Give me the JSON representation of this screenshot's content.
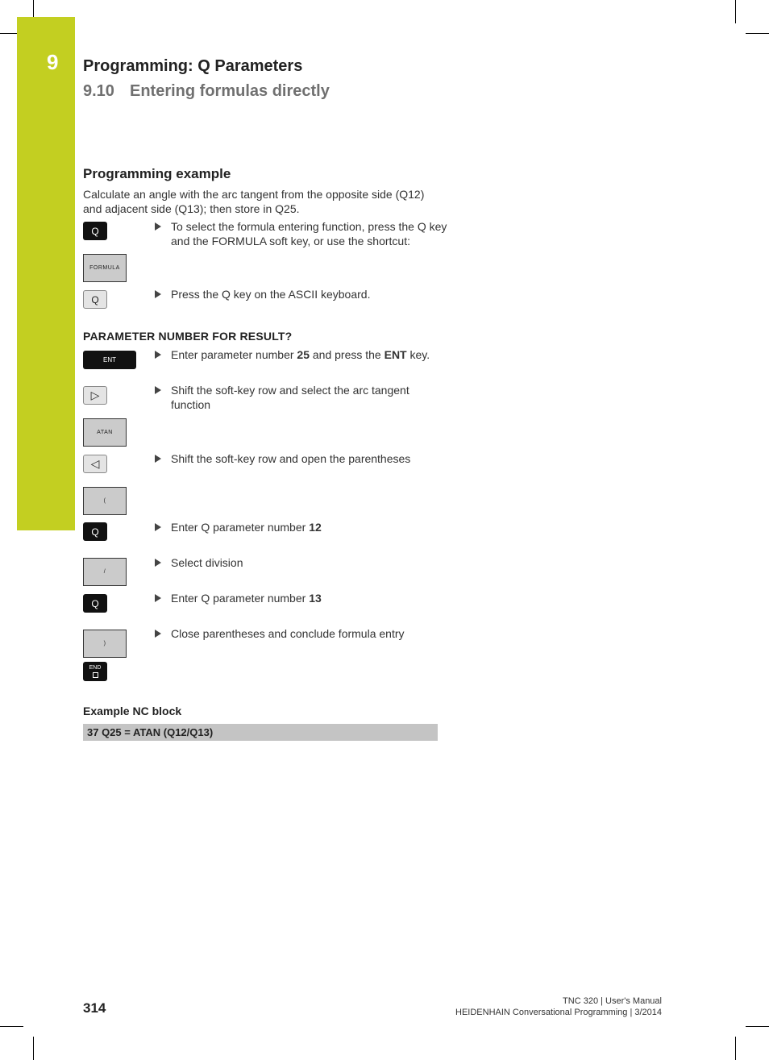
{
  "header": {
    "chapter_number": "9",
    "chapter_title": "Programming: Q Parameters",
    "section_number": "9.10",
    "section_title": "Entering formulas directly"
  },
  "main": {
    "heading": "Programming example",
    "intro": "Calculate an angle with the arc tangent from the opposite side (Q12) and adjacent side (Q13); then store in Q25.",
    "keys": {
      "q_key": "Q",
      "formula_softkey": "FORMULA",
      "ascii_q_key": "Q",
      "ent_key": "ENT",
      "shift_right_icon": "▷",
      "atan_softkey": "ATAN",
      "shift_left_icon": "◁",
      "open_paren_softkey": "(",
      "q_key_2": "Q",
      "division_softkey": "/",
      "q_key_3": "Q",
      "close_paren_softkey": ")",
      "end_key": "END"
    },
    "steps": [
      {
        "text": "To select the formula entering function, press the Q key and the FORMULA soft key, or use the shortcut:"
      },
      {
        "text": "Press the Q key on the ASCII keyboard."
      },
      {
        "pre": "Enter parameter number ",
        "b1": "25",
        "mid": " and press the ",
        "b2": "ENT",
        "post": " key."
      },
      {
        "text": "Shift the soft-key row and select the arc tangent function"
      },
      {
        "text": "Shift the soft-key row and open the parentheses"
      },
      {
        "pre": "Enter Q parameter number ",
        "b1": "12"
      },
      {
        "text": "Select division"
      },
      {
        "pre": "Enter Q parameter number ",
        "b1": "13"
      },
      {
        "text": "Close parentheses and conclude formula entry"
      }
    ],
    "prompt": "PARAMETER NUMBER FOR RESULT?",
    "example_heading": "Example NC block",
    "nc_block": "37 Q25 = ATAN (Q12/Q13)"
  },
  "footer": {
    "page_number": "314",
    "line1": "TNC 320 | User's Manual",
    "line2": "HEIDENHAIN Conversational Programming | 3/2014"
  },
  "colors": {
    "chapter_tab": "#c3cf21",
    "nc_block_bg": "#c4c4c4",
    "softkey_bg": "#cbcbcb"
  }
}
